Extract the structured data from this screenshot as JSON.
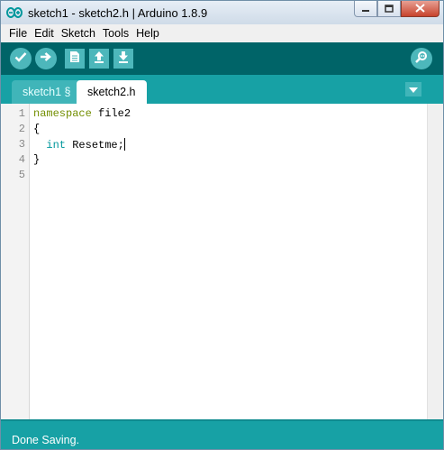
{
  "window": {
    "title": "sketch1 - sketch2.h | Arduino 1.8.9"
  },
  "menu": [
    "File",
    "Edit",
    "Sketch",
    "Tools",
    "Help"
  ],
  "toolbar": {
    "buttons": [
      "verify-icon",
      "upload-icon",
      "new-icon",
      "open-icon",
      "save-icon"
    ],
    "serial_monitor": "serial-monitor-icon"
  },
  "tabs": [
    {
      "label": "sketch1 §",
      "active": false
    },
    {
      "label": "sketch2.h",
      "active": true
    }
  ],
  "editor": {
    "line_numbers": [
      "1",
      "2",
      "3",
      "4",
      "5"
    ],
    "lines": {
      "l1_kw": "namespace",
      "l1_rest": " file2",
      "l2": "{",
      "l3_indent": "  ",
      "l3_kw": "int",
      "l3_rest": " Resetme;",
      "l4": "}",
      "l5": ""
    }
  },
  "status": {
    "message": "Done Saving."
  },
  "colors": {
    "toolbar": "#006468",
    "tabbar": "#17a1a5",
    "button": "#4db7bb",
    "keyword_namespace": "#728e00",
    "keyword_type": "#00979c"
  }
}
